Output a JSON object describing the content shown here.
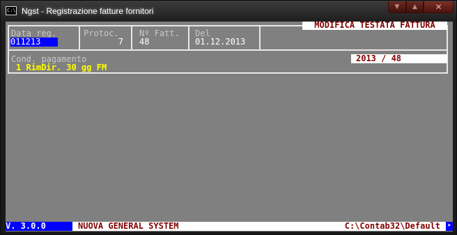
{
  "window": {
    "title": "Ngst - Registrazione fatture fornitori",
    "icon_label": "C:\\",
    "buttons": {
      "minimize": "minimize-icon",
      "maximize": "maximize-icon",
      "close": "close-icon"
    }
  },
  "header": {
    "mode_label": "MODIFICA TESTATA FATTURA",
    "data_reg_label": "Data reg.",
    "data_reg_value": "011213",
    "protoc_label": "Protoc.",
    "protoc_value": "7",
    "nfatt_label": "Nº Fatt.",
    "nfatt_value": "48",
    "del_label": "Del",
    "del_value": "01.12.2013",
    "cond_label": "Cond. pagamento",
    "cond_value": "1 RimDir. 30 gg FM",
    "year_doc": "2013 / 48"
  },
  "status_bar": {
    "version": "V. 3.0.0",
    "system": "NUOVA GENERAL SYSTEM",
    "path": "C:\\Contab32\\Default"
  },
  "colors": {
    "console_bg": "#808080",
    "label": "#c8c8c8",
    "highlight_bg": "#0000ff",
    "accent_yellow": "#ffff00",
    "accent_red": "#800000"
  }
}
